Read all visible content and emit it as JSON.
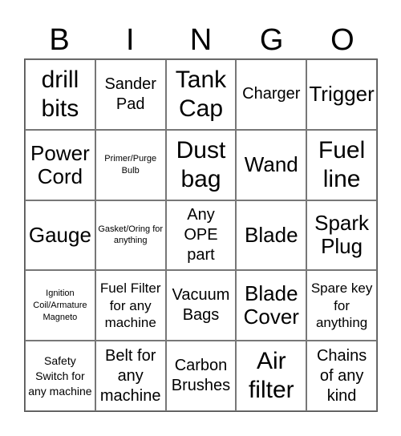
{
  "header": {
    "letters": [
      "B",
      "I",
      "N",
      "G",
      "O"
    ]
  },
  "cells": [
    [
      "drill bits",
      "Sander Pad",
      "Tank Cap",
      "Charger",
      "Trigger"
    ],
    [
      "Power Cord",
      "Primer/Purge Bulb",
      "Dust bag",
      "Wand",
      "Fuel line"
    ],
    [
      "Gauge",
      "Gasket/Oring for anything",
      "Any OPE part",
      "Blade",
      "Spark Plug"
    ],
    [
      "Ignition Coil/Armature Magneto",
      "Fuel Filter for any machine",
      "Vacuum Bags",
      "Blade Cover",
      "Spare key for anything"
    ],
    [
      "Safety Switch for any machine",
      "Belt for any machine",
      "Carbon Brushes",
      "Air filter",
      "Chains of any kind"
    ]
  ]
}
